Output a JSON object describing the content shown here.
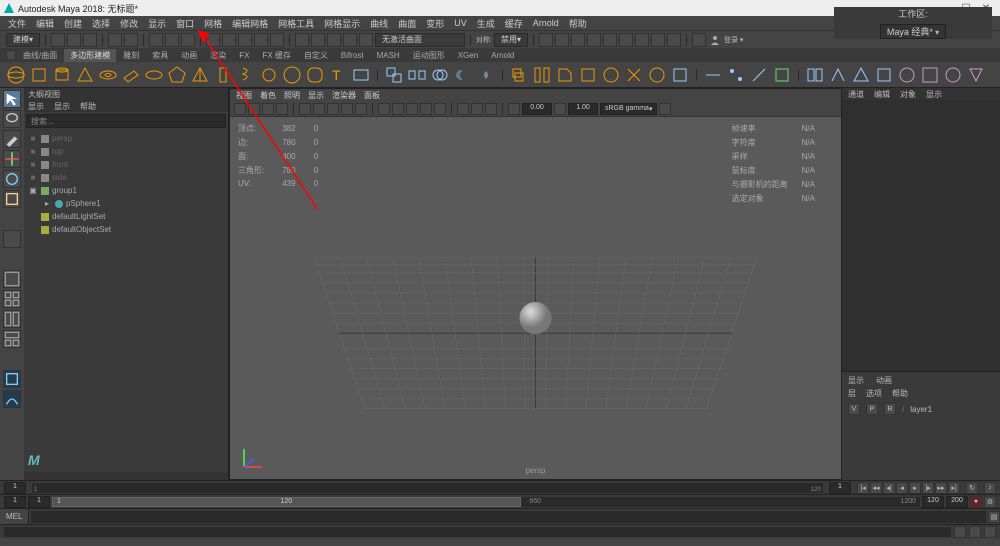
{
  "titlebar": {
    "text": "Autodesk Maya 2018: 无标题*"
  },
  "menubar": {
    "items": [
      "文件",
      "编辑",
      "创建",
      "选择",
      "修改",
      "显示",
      "窗口",
      "网格",
      "编辑网格",
      "网格工具",
      "网格显示",
      "曲线",
      "曲面",
      "变形",
      "UV",
      "生成",
      "缓存",
      "Arnold",
      "帮助"
    ],
    "workspace_label": "工作区:",
    "workspace_value": "Maya 经典*"
  },
  "toolbar1": {
    "mode": "建模",
    "curvepanel_label": "无激活曲面",
    "sym_label": "对称:",
    "sym_value": "禁用"
  },
  "shelftabs": [
    "曲线/曲面",
    "多边形建模",
    "雕刻",
    "索具",
    "动画",
    "渲染",
    "FX",
    "FX 缓存",
    "自定义",
    "Bifrost",
    "MASH",
    "运动图形",
    "XGen",
    "Arnold"
  ],
  "shelftab_active": 1,
  "outliner": {
    "title": "大纲视图",
    "menus": [
      "显示",
      "显示",
      "帮助"
    ],
    "search_placeholder": "搜索...",
    "items": [
      {
        "type": "cam",
        "label": "persp",
        "dim": true,
        "indent": 0,
        "expand": "■"
      },
      {
        "type": "cam",
        "label": "top",
        "dim": true,
        "indent": 0,
        "expand": "■"
      },
      {
        "type": "cam",
        "label": "front",
        "dim": true,
        "indent": 0,
        "expand": "■"
      },
      {
        "type": "cam",
        "label": "side",
        "dim": true,
        "indent": 0,
        "expand": "■"
      },
      {
        "type": "group",
        "label": "group1",
        "dim": false,
        "indent": 0,
        "expand": "▣"
      },
      {
        "type": "shape",
        "label": "pSphere1",
        "dim": false,
        "indent": 1,
        "expand": "▸"
      },
      {
        "type": "set",
        "label": "defaultLightSet",
        "dim": false,
        "indent": 0,
        "expand": ""
      },
      {
        "type": "set",
        "label": "defaultObjectSet",
        "dim": false,
        "indent": 0,
        "expand": ""
      }
    ]
  },
  "viewport": {
    "menus": [
      "视图",
      "着色",
      "照明",
      "显示",
      "渲染器",
      "面板"
    ],
    "hud_left": [
      [
        "顶点:",
        "382",
        "0"
      ],
      [
        "边:",
        "780",
        "0"
      ],
      [
        "面:",
        "400",
        "0"
      ],
      [
        "三角形:",
        "780",
        "0"
      ],
      [
        "UV:",
        "439",
        "0"
      ]
    ],
    "hud_right": [
      [
        "帧速率",
        "N/A"
      ],
      [
        "字符度",
        "N/A"
      ],
      [
        "采样",
        "N/A"
      ],
      [
        "鼠标度",
        "N/A"
      ],
      [
        "与摄影机的距离",
        "N/A"
      ],
      [
        "选定对象",
        "N/A"
      ]
    ],
    "gamma_value": "sRGB gamma",
    "near": "0.00",
    "far": "1.00",
    "camera_label": "persp"
  },
  "right": {
    "tabs": [
      "通道",
      "编辑",
      "对象",
      "显示"
    ],
    "section2_title": "显示",
    "section2_tab": "动画",
    "section2_menus": [
      "层",
      "选项",
      "帮助"
    ],
    "layers_row": [
      "V",
      "P",
      "R",
      "/",
      "layer1"
    ]
  },
  "time": {
    "start": "1",
    "current": "1",
    "range_end": "120",
    "end": "200",
    "ticks_top": [
      "1",
      "",
      "",
      "",
      "",
      "",
      "",
      "",
      "",
      "",
      "",
      "",
      "",
      "",
      "",
      "",
      "",
      "",
      "",
      "",
      "",
      "",
      "120"
    ],
    "ticks_range": [
      "1",
      "120",
      "660",
      "120",
      "1200"
    ]
  },
  "cmd": {
    "label": "MEL"
  }
}
